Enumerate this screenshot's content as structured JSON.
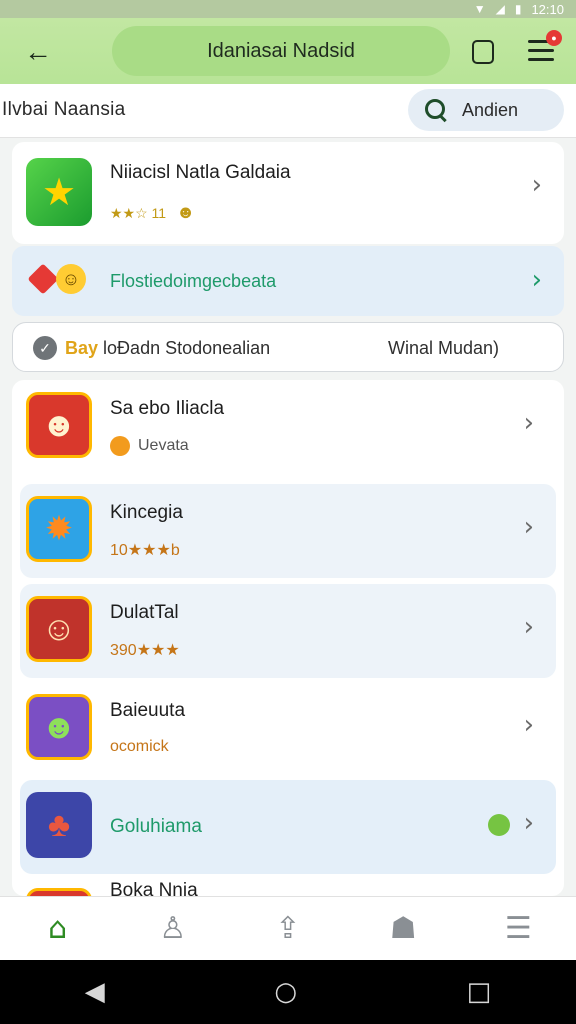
{
  "status_bar": {
    "time": "12:10"
  },
  "app_bar": {
    "title": "Idaniasai Nadsid"
  },
  "search_row": {
    "label": "Ilvbai Naansia",
    "search_button": "Andien"
  },
  "featured": {
    "name": "Niiacisl Natla Galdaia",
    "rating": "★★☆ 11"
  },
  "promo": {
    "text": "Flostiedoimgecbeata"
  },
  "info_bar": {
    "highlight": "Bay",
    "text": "loÐadn Stodonealian",
    "right": "Winal Mudan)"
  },
  "games": [
    {
      "name": "Sa ebo Iliacla",
      "sub": "Uevata"
    },
    {
      "name": "Kincegia",
      "sub": "10★★★b"
    },
    {
      "name": "DulatTal",
      "sub": "390★★★"
    },
    {
      "name": "Baieuuta",
      "sub": "ocomick"
    },
    {
      "name": "Goluhiama"
    },
    {
      "name": "Boka Nnia"
    }
  ],
  "colors": {
    "accent": "#2e8b23",
    "app_bar": "#b8e497",
    "promo_text": "#1e9a6a"
  }
}
